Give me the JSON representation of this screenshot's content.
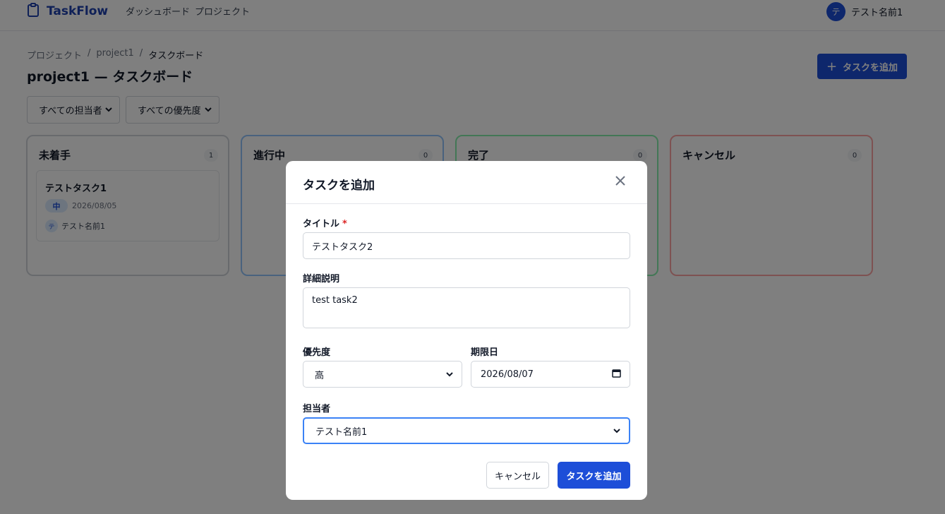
{
  "app": {
    "name": "TaskFlow"
  },
  "nav": {
    "dashboard": "ダッシュボード",
    "projects": "プロジェクト"
  },
  "user": {
    "initial": "テ",
    "name": "テスト名前1"
  },
  "breadcrumb": {
    "root": "プロジェクト",
    "sep1": "/",
    "project": "project1",
    "sep2": "/",
    "current": "タスクボード"
  },
  "page": {
    "title": "project1 — タスクボード"
  },
  "add_task_button": {
    "icon": "+",
    "label": "タスクを追加"
  },
  "filters": {
    "assignee": "すべての担当者",
    "priority": "すべての優先度"
  },
  "columns": [
    {
      "title": "未着手",
      "count": "1",
      "border_color": "#d1d5db"
    },
    {
      "title": "進行中",
      "count": "0",
      "border_color": "#93c5fd"
    },
    {
      "title": "完了",
      "count": "0",
      "border_color": "#86efac"
    },
    {
      "title": "キャンセル",
      "count": "0",
      "border_color": "#fca5a5"
    }
  ],
  "card": {
    "title": "テストタスク1",
    "priority": "中",
    "due": "2026/08/05",
    "assignee_initial": "テ",
    "assignee": "テスト名前1"
  },
  "modal": {
    "title": "タスクを追加",
    "title_label": "タイトル",
    "required_mark": "*",
    "title_value": "テストタスク2",
    "description_label": "詳細説明",
    "description_value": "test task2",
    "priority_label": "優先度",
    "priority_value": "高",
    "due_label": "期限日",
    "due_value": "2026/08/07",
    "assignee_label": "担当者",
    "assignee_value": "テスト名前1",
    "cancel_label": "キャンセル",
    "submit_label": "タスクを追加"
  },
  "colors": {
    "primary": "#1d4ed8",
    "overlay": "rgba(0,0,0,0.5)"
  }
}
